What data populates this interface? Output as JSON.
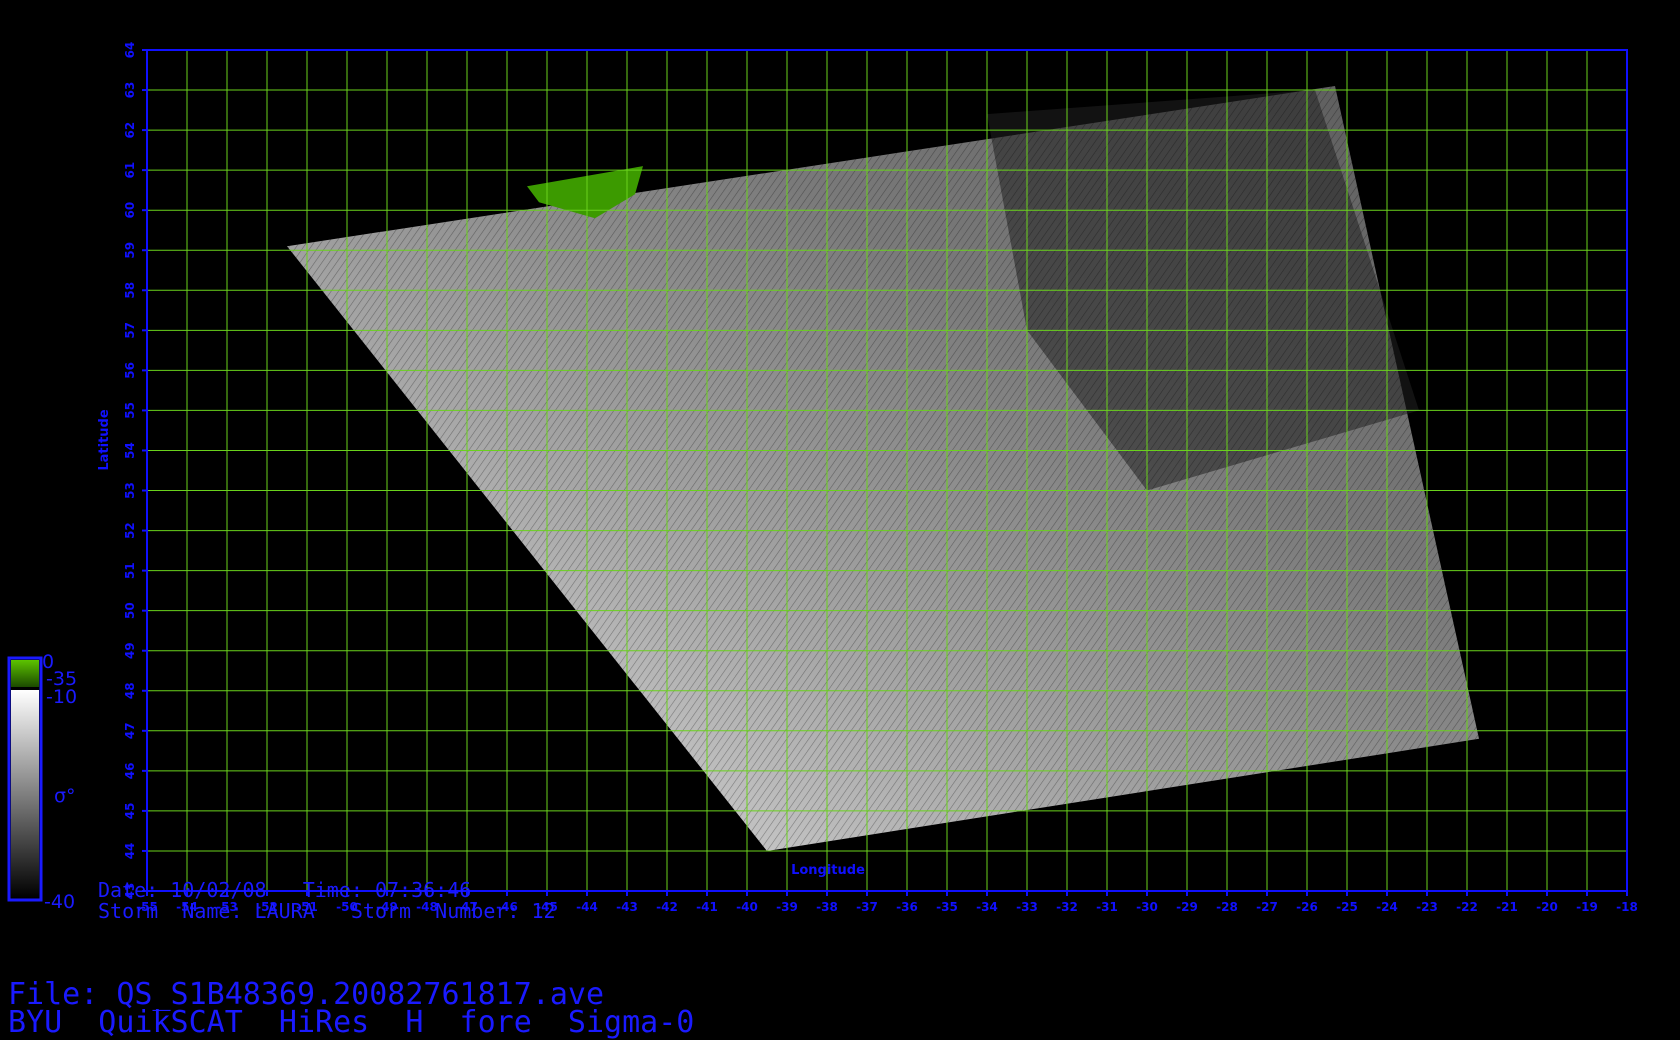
{
  "map": {
    "lon_ticks": [
      "-55",
      "-54",
      "-53",
      "-52",
      "-51",
      "-50",
      "-49",
      "-48",
      "-47",
      "-46",
      "-45",
      "-44",
      "-43",
      "-42",
      "-41",
      "-40",
      "-39",
      "-38",
      "-37",
      "-36",
      "-35",
      "-34",
      "-33",
      "-32",
      "-31",
      "-30",
      "-29",
      "-28",
      "-27",
      "-26",
      "-25",
      "-24",
      "-23",
      "-22",
      "-21",
      "-20",
      "-19",
      "-18"
    ],
    "lat_ticks": [
      "43",
      "44",
      "45",
      "46",
      "47",
      "48",
      "49",
      "50",
      "51",
      "52",
      "53",
      "54",
      "55",
      "56",
      "57",
      "58",
      "59",
      "60",
      "61",
      "62",
      "63",
      "64"
    ],
    "lon_range": [
      -55,
      -18
    ],
    "lat_range": [
      43,
      64
    ],
    "xlabel": "Longitude",
    "ylabel": "Latitude",
    "grid": true,
    "colors": {
      "frame": "#1010ff",
      "grid": "#6ad21c",
      "land": "#3c9a00",
      "background": "#000000"
    },
    "swath_corners": [
      {
        "lon": -51.5,
        "lat": 59.1
      },
      {
        "lon": -25.3,
        "lat": 63.1
      },
      {
        "lon": -21.7,
        "lat": 46.8
      },
      {
        "lon": -39.5,
        "lat": 44.0
      }
    ]
  },
  "colorbar": {
    "labels": {
      "top": "0",
      "green_bottom": "-35",
      "gray_top": "-10",
      "bottom": "-40",
      "symbol": "σ°"
    },
    "colors": {
      "green": "#40a000",
      "gray_light": "#ffffff",
      "gray_dark": "#000000"
    }
  },
  "info": {
    "date_time": "Date: 10/02/08   Time: 07:36:46",
    "storm": "Storm  Name: LAURA   Storm  Number: 12",
    "file": "File: QS_S1B48369.20082761817.ave",
    "product": "BYU  QuikSCAT  HiRes  H  fore  Sigma-0"
  }
}
